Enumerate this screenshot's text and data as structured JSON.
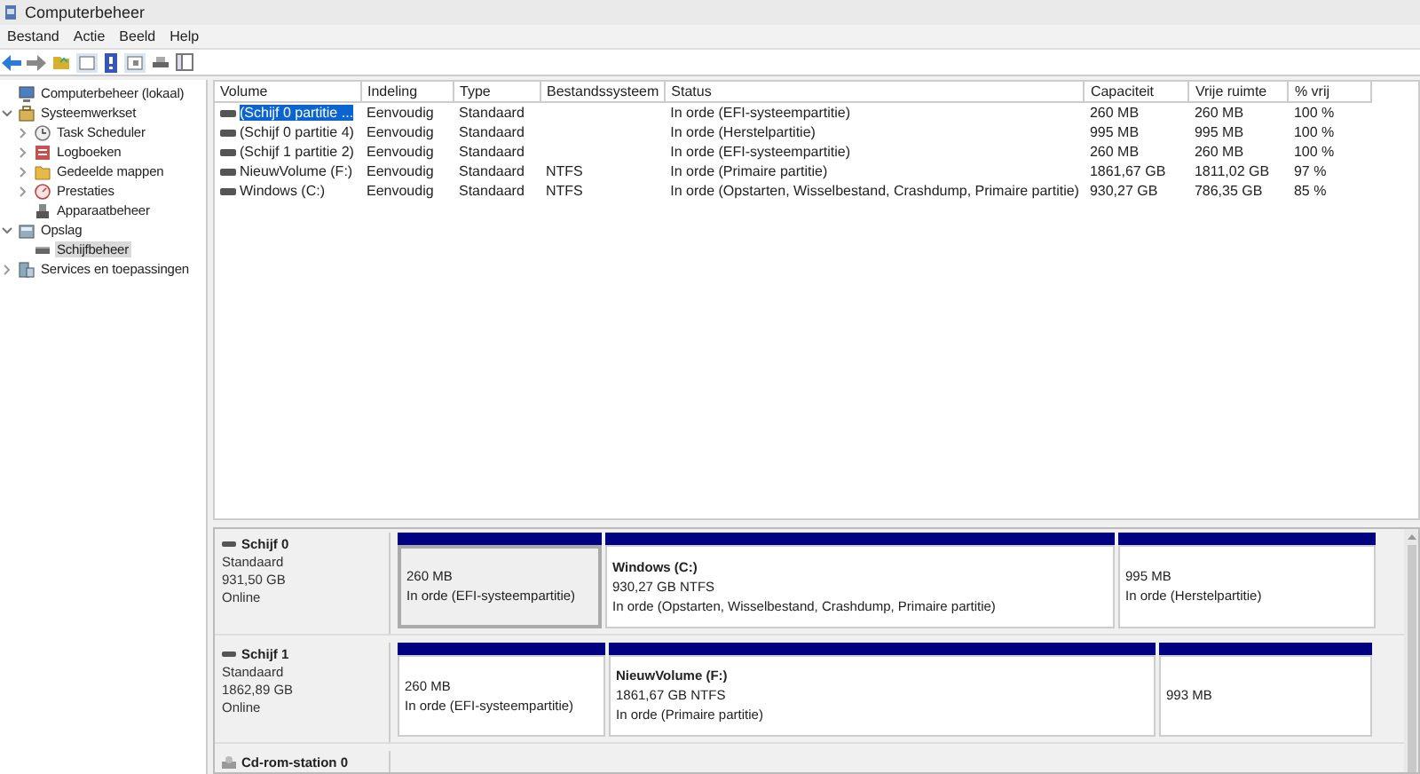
{
  "window": {
    "title": "Computerbeheer"
  },
  "menu": [
    {
      "label": "Bestand"
    },
    {
      "label": "Actie"
    },
    {
      "label": "Beeld"
    },
    {
      "label": "Help"
    }
  ],
  "tree": [
    {
      "label": "Computerbeheer (lokaal)",
      "selected": false,
      "children": [
        {
          "label": "Systeemwerkset",
          "selected": false,
          "expanded": true,
          "children": [
            {
              "label": "Task Scheduler",
              "selected": false,
              "expanded": false
            },
            {
              "label": "Logboeken",
              "selected": false,
              "expanded": false
            },
            {
              "label": "Gedeelde mappen",
              "selected": false,
              "expanded": false
            },
            {
              "label": "Prestaties",
              "selected": false,
              "expanded": false
            },
            {
              "label": "Apparaatbeheer",
              "selected": false
            }
          ]
        },
        {
          "label": "Opslag",
          "selected": false,
          "expanded": true,
          "children": [
            {
              "label": "Schijfbeheer",
              "selected": true
            }
          ]
        },
        {
          "label": "Services en toepassingen",
          "selected": false,
          "expanded": false
        }
      ]
    }
  ],
  "table": {
    "columns": [
      "Volume",
      "Indeling",
      "Type",
      "Bestandssysteem",
      "Status",
      "Capaciteit",
      "Vrije ruimte",
      "% vrij"
    ],
    "rows": [
      {
        "selected": true,
        "cells": [
          "(Schijf 0 partitie ...",
          "Eenvoudig",
          "Standaard",
          "",
          "In orde (EFI-systeempartitie)",
          "260 MB",
          "260 MB",
          "100 %"
        ]
      },
      {
        "selected": false,
        "cells": [
          "(Schijf 0 partitie 4)",
          "Eenvoudig",
          "Standaard",
          "",
          "In orde (Herstelpartitie)",
          "995 MB",
          "995 MB",
          "100 %"
        ]
      },
      {
        "selected": false,
        "cells": [
          "(Schijf 1 partitie 2)",
          "Eenvoudig",
          "Standaard",
          "",
          "In orde (EFI-systeempartitie)",
          "260 MB",
          "260 MB",
          "100 %"
        ]
      },
      {
        "selected": false,
        "cells": [
          "NieuwVolume (F:)",
          "Eenvoudig",
          "Standaard",
          "NTFS",
          "In orde (Primaire partitie)",
          "1861,67 GB",
          "1811,02 GB",
          "97 %"
        ]
      },
      {
        "selected": false,
        "cells": [
          "Windows (C:)",
          "Eenvoudig",
          "Standaard",
          "NTFS",
          "In orde (Opstarten, Wisselbestand, Crashdump, Primaire partitie)",
          "930,27 GB",
          "786,35 GB",
          "85 %"
        ]
      }
    ]
  },
  "disks": [
    {
      "name": "Schijf 0",
      "kind": "disk",
      "type": "Standaard",
      "size": "931,50 GB",
      "status": "Online",
      "partitions": [
        {
          "selected": true,
          "size": "260 MB",
          "status": "In orde (EFI-systeempartitie)"
        },
        {
          "selected": false,
          "title": "Windows  (C:)",
          "size": "930,27 GB NTFS",
          "status": "In orde (Opstarten, Wisselbestand, Crashdump, Primaire partitie)"
        },
        {
          "selected": false,
          "size": "995 MB",
          "status": "In orde (Herstelpartitie)"
        }
      ]
    },
    {
      "name": "Schijf 1",
      "kind": "disk",
      "type": "Standaard",
      "size": "1862,89 GB",
      "status": "Online",
      "partitions": [
        {
          "selected": false,
          "size": "260 MB",
          "status": "In orde (EFI-systeempartitie)"
        },
        {
          "selected": false,
          "title": "NieuwVolume  (F:)",
          "size": "1861,67 GB NTFS",
          "status": "In orde (Primaire partitie)"
        },
        {
          "selected": false,
          "size": "993 MB"
        }
      ]
    },
    {
      "name": "Cd-rom-station 0",
      "kind": "cdrom"
    }
  ]
}
